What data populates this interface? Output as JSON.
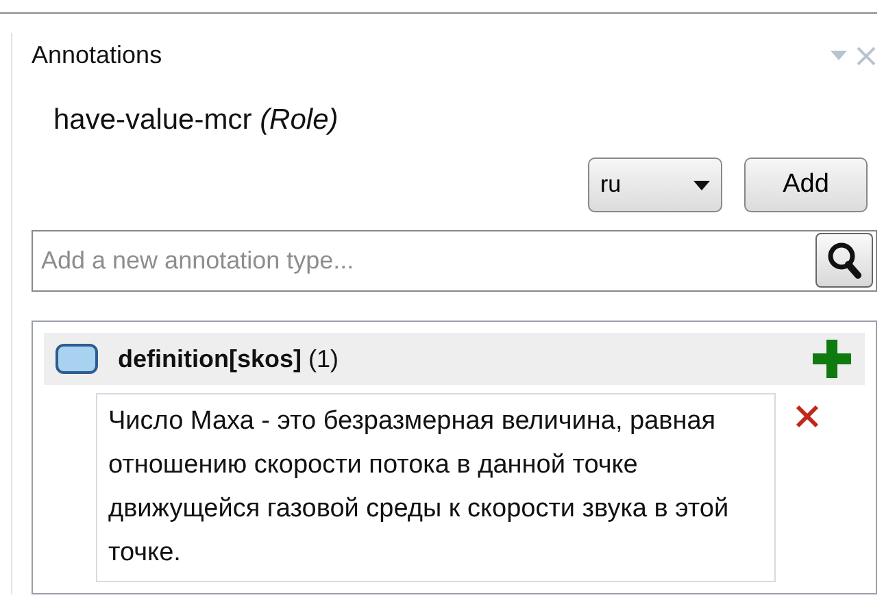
{
  "panel": {
    "title": "Annotations"
  },
  "entity": {
    "title": "have-value-mcr *(Role)*"
  },
  "language": {
    "value": "ru"
  },
  "add_button": "Add",
  "search": {
    "placeholder": "Add a new annotation type..."
  },
  "annotations": [
    {
      "header": "**definition[skos]** (1)",
      "values": [
        "Число Маха - это безразмерная величина, равная отношению скорости потока в данной точке движущейся газовой среды к скорости звука в этой точке."
      ]
    }
  ]
}
